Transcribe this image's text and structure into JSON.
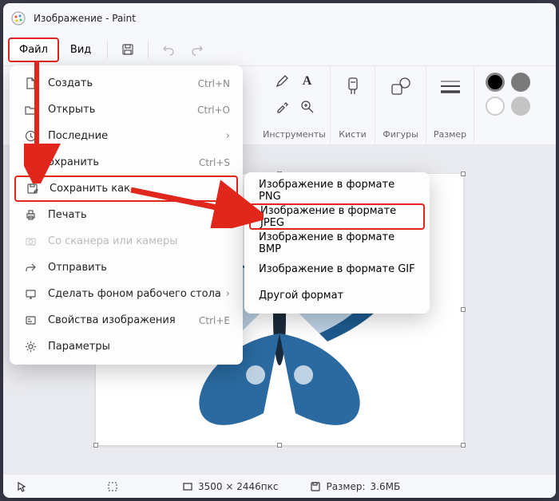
{
  "title": "Изображение - Paint",
  "menubar": {
    "file": "Файл",
    "view": "Вид"
  },
  "ribbon": {
    "tools": "Инструменты",
    "brushes": "Кисти",
    "shapes": "Фигуры",
    "size": "Размер"
  },
  "file_menu": {
    "new": {
      "label": "Создать",
      "shortcut": "Ctrl+N"
    },
    "open": {
      "label": "Открыть",
      "shortcut": "Ctrl+O"
    },
    "recent": {
      "label": "Последние"
    },
    "save": {
      "label": "охранить",
      "shortcut": "Ctrl+S"
    },
    "save_as": {
      "label": "Сохранить как"
    },
    "print": {
      "label": "Печать"
    },
    "scanner": {
      "label": "Со сканера или камеры"
    },
    "send": {
      "label": "Отправить"
    },
    "wallpaper": {
      "label": "Сделать фоном рабочего стола"
    },
    "properties": {
      "label": "Свойства изображения",
      "shortcut": "Ctrl+E"
    },
    "settings": {
      "label": "Параметры"
    }
  },
  "save_as_menu": {
    "png": "Изображение в формате PNG",
    "jpeg": "Изображение в формате JPEG",
    "bmp": "Изображение в формате BMP",
    "gif": "Изображение в формате GIF",
    "other": "Другой формат"
  },
  "statusbar": {
    "dims": "3500 × 2446пкс",
    "size_label": "Размер:",
    "size_value": "3.6МБ"
  },
  "colors": {
    "c1": "#000000",
    "c2": "#ffffff"
  }
}
